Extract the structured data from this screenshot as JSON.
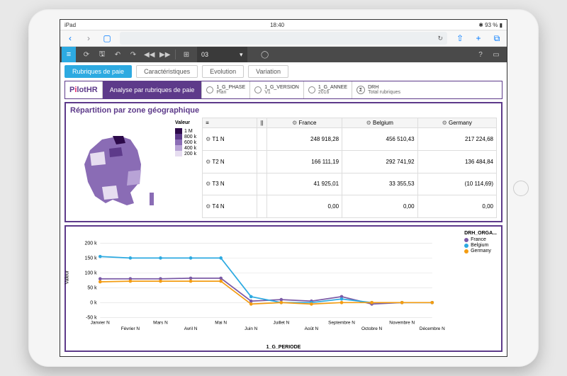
{
  "status": {
    "carrier": "iPad",
    "time": "18:40",
    "battery": "93 %"
  },
  "browser": {
    "refresh_icon": "↻"
  },
  "toolbar": {
    "dd_value": "03"
  },
  "tabs": [
    {
      "label": "Rubriques de paie",
      "active": true
    },
    {
      "label": "Caractéristiques",
      "active": false
    },
    {
      "label": "Evolution",
      "active": false
    },
    {
      "label": "Variation",
      "active": false
    }
  ],
  "logo": {
    "p": "P",
    "i": "i",
    "lot": "lot",
    "hr": "HR"
  },
  "analyse_title": "Analyse par rubriques de paie",
  "filters": [
    {
      "key": "1_G_PHASE",
      "val": "Plan",
      "sigma": false
    },
    {
      "key": "1_G_VERSION",
      "val": "V1",
      "sigma": false
    },
    {
      "key": "1_G_ANNEE",
      "val": "2016",
      "sigma": false
    },
    {
      "key": "DRH",
      "val": "Total rubriques",
      "sigma": true
    }
  ],
  "panel1_title": "Répartition par zone géographique",
  "legend_title": "Valeur",
  "legend_items": [
    {
      "label": "1 M",
      "color": "#2d0a4a"
    },
    {
      "label": "800 k",
      "color": "#5d3a8a"
    },
    {
      "label": "600 k",
      "color": "#8a6cb5"
    },
    {
      "label": "400 k",
      "color": "#b8a3d6"
    },
    {
      "label": "200 k",
      "color": "#e6ddf0"
    }
  ],
  "table": {
    "row_header": "≡",
    "cols": [
      "France",
      "Belgium",
      "Germany"
    ],
    "rows": [
      {
        "label": "T1 N",
        "vals": [
          "248 918,28",
          "456 510,43",
          "217 224,68"
        ]
      },
      {
        "label": "T2 N",
        "vals": [
          "166 111,19",
          "292 741,92",
          "136 484,84"
        ]
      },
      {
        "label": "T3 N",
        "vals": [
          "41 925,01",
          "33 355,53",
          "(10 114,69)"
        ]
      },
      {
        "label": "T4 N",
        "vals": [
          "0,00",
          "0,00",
          "0,00"
        ]
      }
    ]
  },
  "chart_data": {
    "type": "line",
    "title": "",
    "xlabel": "1_G_PERIODE",
    "ylabel": "Valeur",
    "ylim": [
      -50000,
      200000
    ],
    "yticks": [
      "-50 k",
      "0 k",
      "50 k",
      "100 k",
      "150 k",
      "200 k"
    ],
    "legend_title": "DRH_ORGA...",
    "categories": [
      "Janvier N",
      "Février N",
      "Mars N",
      "Avril N",
      "Mai N",
      "Juin N",
      "Juillet N",
      "Août N",
      "Septembre N",
      "Octobre N",
      "Novembre N",
      "Décembre N"
    ],
    "series": [
      {
        "name": "France",
        "color": "#7b5aa6",
        "values": [
          80000,
          80000,
          80000,
          82000,
          82000,
          5000,
          10000,
          5000,
          20000,
          -5000,
          0,
          0
        ]
      },
      {
        "name": "Belgium",
        "color": "#2daae1",
        "values": [
          155000,
          150000,
          150000,
          150000,
          150000,
          20000,
          0,
          0,
          12000,
          0,
          0,
          0
        ]
      },
      {
        "name": "Germany",
        "color": "#f39c12",
        "values": [
          70000,
          72000,
          72000,
          72000,
          72000,
          -5000,
          0,
          -5000,
          0,
          0,
          0,
          0
        ]
      }
    ]
  }
}
